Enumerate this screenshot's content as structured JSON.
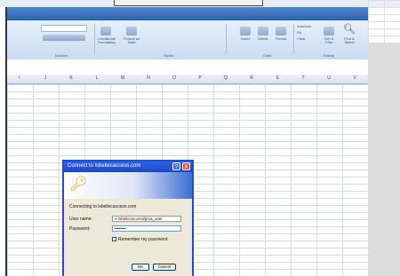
{
  "ribbon": {
    "groups": {
      "number": "Number",
      "styles": "Styles",
      "cells": "Cells",
      "editing": "Editing"
    },
    "buttons": {
      "conditional_formatting": "Conditional Formatting",
      "format_as_table": "Format as Table",
      "insert": "Insert",
      "delete": "Delete",
      "format": "Format",
      "autosum": "AutoSum",
      "fill": "Fill",
      "clear": "Clear",
      "sort_filter": "Sort & Filter",
      "find_select": "Find & Select"
    }
  },
  "sheet": {
    "columns": [
      "I",
      "J",
      "K",
      "L",
      "M",
      "N",
      "O",
      "P",
      "Q",
      "R",
      "S",
      "T",
      "U",
      "V"
    ]
  },
  "dialog": {
    "title": "Connect to lsbeliecaccess.com",
    "connecting_text": "Connecting to lsbeliecaccess.com",
    "username_label": "User name:",
    "username_value": "lsbeliecaccess\\jima_user",
    "password_label": "Password:",
    "password_value": "••••••••",
    "remember_label": "Remember my password",
    "ok_label": "OK",
    "cancel_label": "Cancel",
    "help_glyph": "?",
    "close_glyph": "X"
  }
}
